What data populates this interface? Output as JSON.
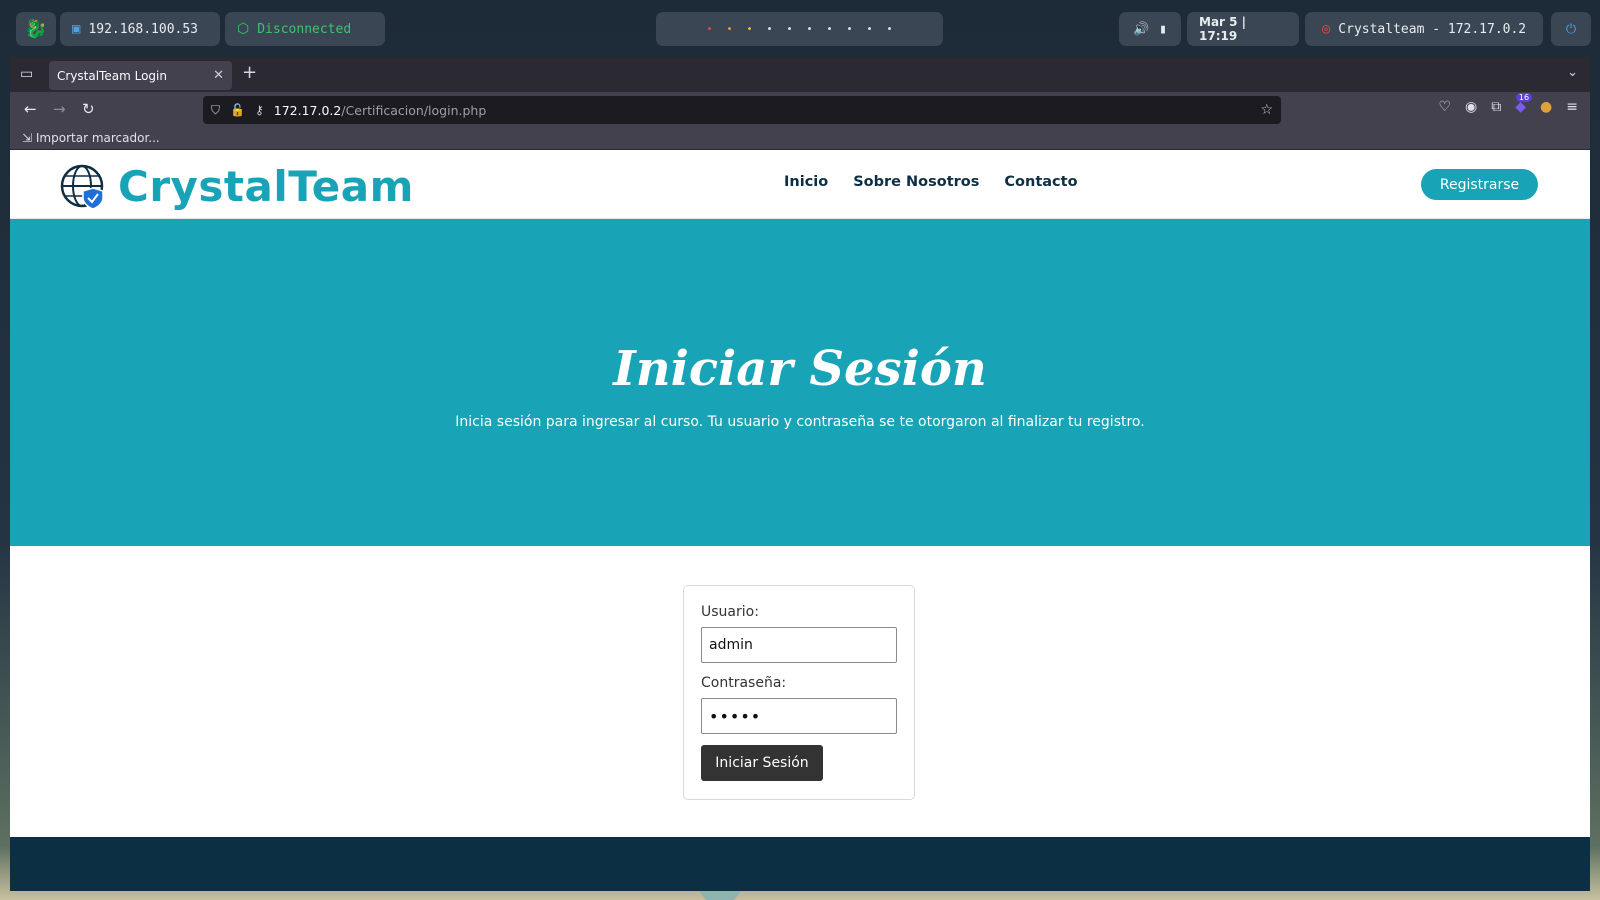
{
  "top_panel": {
    "local_ip": "192.168.100.53",
    "vpn_status": "Disconnected",
    "workspaces": [
      "•",
      "•",
      "•",
      "•",
      "•",
      "•",
      "•",
      "•",
      "•",
      "•"
    ],
    "datetime": "Mar 5 | 17:19",
    "target": "Crystalteam - 172.17.0.2",
    "colors": {
      "vpn_status": "#3cc46d",
      "target_icon": "#e84848",
      "accent": "#4aa3e8"
    }
  },
  "browser": {
    "tab_title": "CrystalTeam Login",
    "url_host": "172.17.0.2",
    "url_path": "/Certificacion/login.php",
    "bookmark_item": "Importar marcador...",
    "extension_badge": "16"
  },
  "site": {
    "brand": "CrystalTeam",
    "nav": [
      "Inicio",
      "Sobre Nosotros",
      "Contacto"
    ],
    "register_label": "Registrarse",
    "hero_title": "Iniciar Sesión",
    "hero_subtitle": "Inicia sesión para ingresar al curso. Tu usuario y contraseña se te otorgaron al finalizar tu registro.",
    "form": {
      "username_label": "Usuario:",
      "username_value": "admin",
      "password_label": "Contraseña:",
      "password_value": "•••••",
      "submit_label": "Iniciar Sesión"
    },
    "colors": {
      "primary": "#18a3b6",
      "nav_text": "#0f2e44",
      "footer": "#0c2f44",
      "button": "#333333"
    }
  }
}
